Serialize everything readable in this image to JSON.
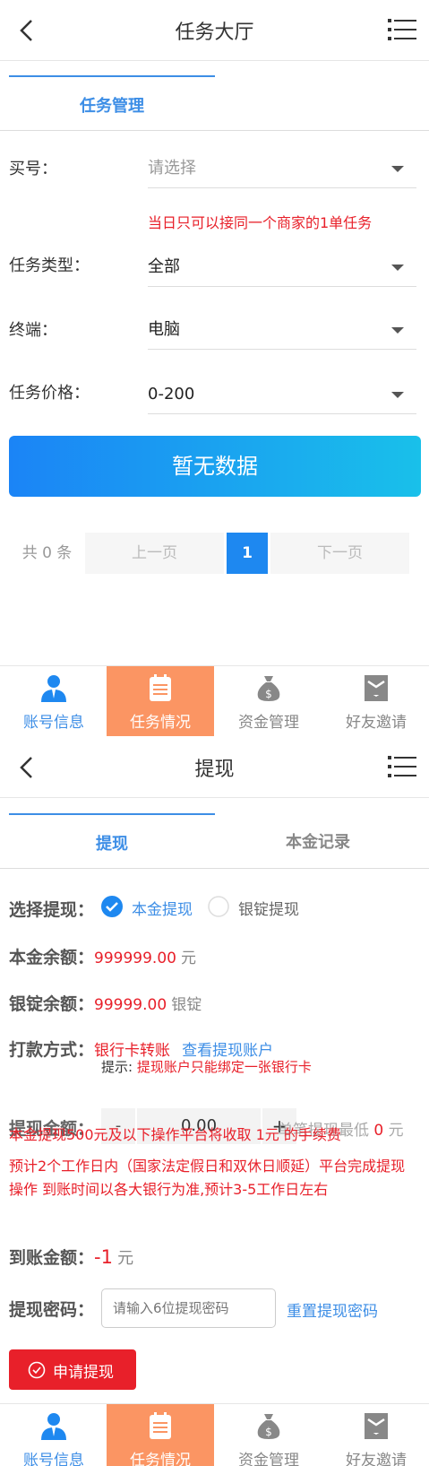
{
  "screen1": {
    "header": {
      "title": "任务大厅"
    },
    "tabs": [
      {
        "label": "任务管理",
        "active": true
      }
    ],
    "form": {
      "account": {
        "label": "买号：",
        "placeholder": "请选择"
      },
      "notice": "当日只可以接同一个商家的1单任务",
      "task_type": {
        "label": "任务类型：",
        "value": "全部"
      },
      "terminal": {
        "label": "终端：",
        "value": "电脑"
      },
      "price": {
        "label": "任务价格：",
        "value": "0-200"
      }
    },
    "no_data_button": "暂无数据",
    "pager": {
      "total": "共 0 条",
      "prev": "上一页",
      "current": "1",
      "next": "下一页"
    }
  },
  "bottom_nav": [
    {
      "label": "账号信息",
      "icon": "user-icon"
    },
    {
      "label": "任务情况",
      "icon": "clipboard-icon",
      "active": true
    },
    {
      "label": "资金管理",
      "icon": "money-bag-icon"
    },
    {
      "label": "好友邀请",
      "icon": "invite-mail-icon"
    }
  ],
  "screen2": {
    "header": {
      "title": "提现"
    },
    "tabs": [
      {
        "label": "提现",
        "active": true
      },
      {
        "label": "本金记录",
        "active": false
      }
    ],
    "choose": {
      "label": "选择提现：",
      "option1": "本金提现",
      "option2": "银锭提现"
    },
    "principal": {
      "label": "本金余额：",
      "amount": "999999.00",
      "unit": "元"
    },
    "ingot": {
      "label": "银锭余额：",
      "amount": "99999.00",
      "unit": "银锭"
    },
    "payment": {
      "label": "打款方式：",
      "method": "银行卡转账",
      "link": "查看提现账户",
      "hint_prefix": "提示:",
      "hint": "提现账户只能绑定一张银行卡"
    },
    "withdraw_amount": {
      "label": "提现金额：",
      "minus": "-",
      "value": "0.00",
      "plus": "+",
      "min_text": "单笔提现最低",
      "min_value": "0",
      "min_unit": "元",
      "fee_notice": "本金提现500元及以下操作平台将收取 1元 的手续费"
    },
    "notice": "预计2个工作日内（国家法定假日和双休日顺延）平台完成提现操作 到账时间以各大银行为准,预计3-5工作日左右",
    "arrival": {
      "label": "到账金额：",
      "value": "-1",
      "unit": "元"
    },
    "password": {
      "label": "提现密码：",
      "placeholder": "请输入6位提现密码",
      "reset_link": "重置提现密码"
    },
    "submit": "申请提现"
  },
  "colors": {
    "accent": "#3d8ee6",
    "red": "#e8202a",
    "orange": "#fb9563"
  }
}
